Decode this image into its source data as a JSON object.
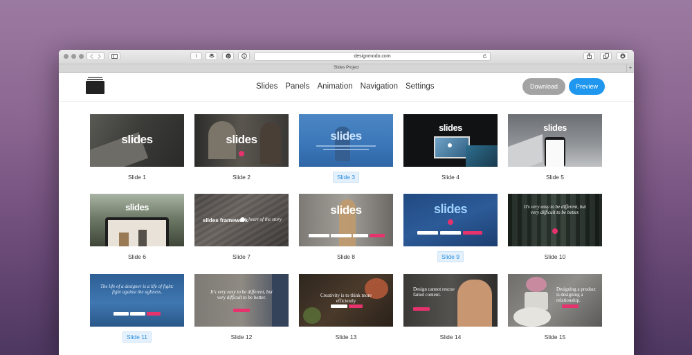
{
  "browser": {
    "url": "designmodo.com",
    "tab_title": "Slides Project",
    "reader_label": "I"
  },
  "app": {
    "nav": [
      "Slides",
      "Panels",
      "Animation",
      "Navigation",
      "Settings"
    ],
    "download_label": "Download",
    "preview_label": "Preview"
  },
  "slides": [
    {
      "caption": "Slide 1",
      "selected": false,
      "text": "slides"
    },
    {
      "caption": "Slide 2",
      "selected": false,
      "text": "slides"
    },
    {
      "caption": "Slide 3",
      "selected": true,
      "text": "slides"
    },
    {
      "caption": "Slide 4",
      "selected": false,
      "text": "slides"
    },
    {
      "caption": "Slide 5",
      "selected": false,
      "text": "slides"
    },
    {
      "caption": "Slide 6",
      "selected": false,
      "text": "slides"
    },
    {
      "caption": "Slide 7",
      "selected": false,
      "text": "slides framework",
      "text2": "heart of the story"
    },
    {
      "caption": "Slide 8",
      "selected": false,
      "text": "slides"
    },
    {
      "caption": "Slide 9",
      "selected": true,
      "text": "slides"
    },
    {
      "caption": "Slide 10",
      "selected": false,
      "text": "It's very easy to be different, but very difficult to be better."
    },
    {
      "caption": "Slide 11",
      "selected": true,
      "text": "The life of a designer is a life of fight: fight against the ugliness."
    },
    {
      "caption": "Slide 12",
      "selected": false,
      "text": "It's very easy to be different, but very difficult to be better."
    },
    {
      "caption": "Slide 13",
      "selected": false,
      "text": "Creativity is to think more efficiently"
    },
    {
      "caption": "Slide 14",
      "selected": false,
      "text": "Design cannot rescue failed content."
    },
    {
      "caption": "Slide 15",
      "selected": false,
      "text": "Designing a product is designing a relationship."
    }
  ],
  "colors": {
    "accent": "#1f97ee",
    "selected_bg": "#e4f1fc",
    "download_bg": "#a3a3a3",
    "cta_pink": "#e6336e"
  }
}
